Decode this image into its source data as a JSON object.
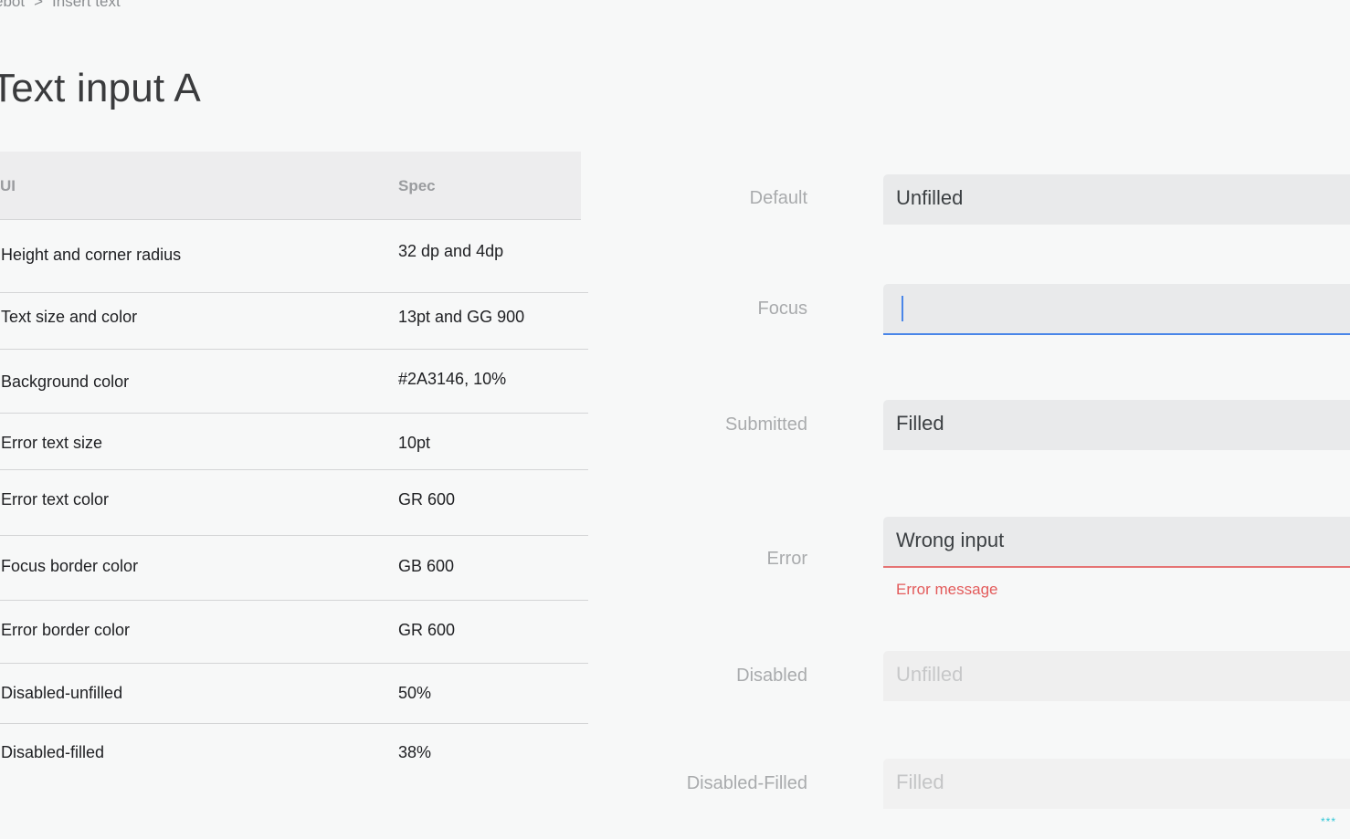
{
  "breadcrumb": {
    "parent": "ebot",
    "separator": ">",
    "current": "Insert text"
  },
  "page_title": "Text input A",
  "spec_table": {
    "headers": {
      "ui": "UI",
      "spec": "Spec"
    },
    "rows": [
      {
        "ui": "Height and corner radius",
        "spec": "32 dp and 4dp"
      },
      {
        "ui": "Text size and color",
        "spec": "13pt and GG 900"
      },
      {
        "ui": "Background color",
        "spec": "#2A3146, 10%"
      },
      {
        "ui": "Error text size",
        "spec": "10pt"
      },
      {
        "ui": "Error text color",
        "spec": "GR 600"
      },
      {
        "ui": "Focus border color",
        "spec": "GB 600"
      },
      {
        "ui": "Error border color",
        "spec": "GR 600"
      },
      {
        "ui": "Disabled-unfilled",
        "spec": "50%"
      },
      {
        "ui": "Disabled-filled",
        "spec": "38%"
      }
    ]
  },
  "states": {
    "default": {
      "label": "Default",
      "value": "Unfilled"
    },
    "focus": {
      "label": "Focus",
      "value": ""
    },
    "submitted": {
      "label": "Submitted",
      "value": "Filled"
    },
    "error": {
      "label": "Error",
      "value": "Wrong input",
      "message": "Error message"
    },
    "disabled": {
      "label": "Disabled",
      "value": "Unfilled"
    },
    "disabled_filled": {
      "label": "Disabled-Filled",
      "value": "Filled"
    }
  },
  "colors": {
    "focus_border": "#4a86e8",
    "error_border": "#e57373",
    "error_text": "#e35b5b",
    "field_background": "#e9eaeb"
  },
  "corner_indicator": "***"
}
